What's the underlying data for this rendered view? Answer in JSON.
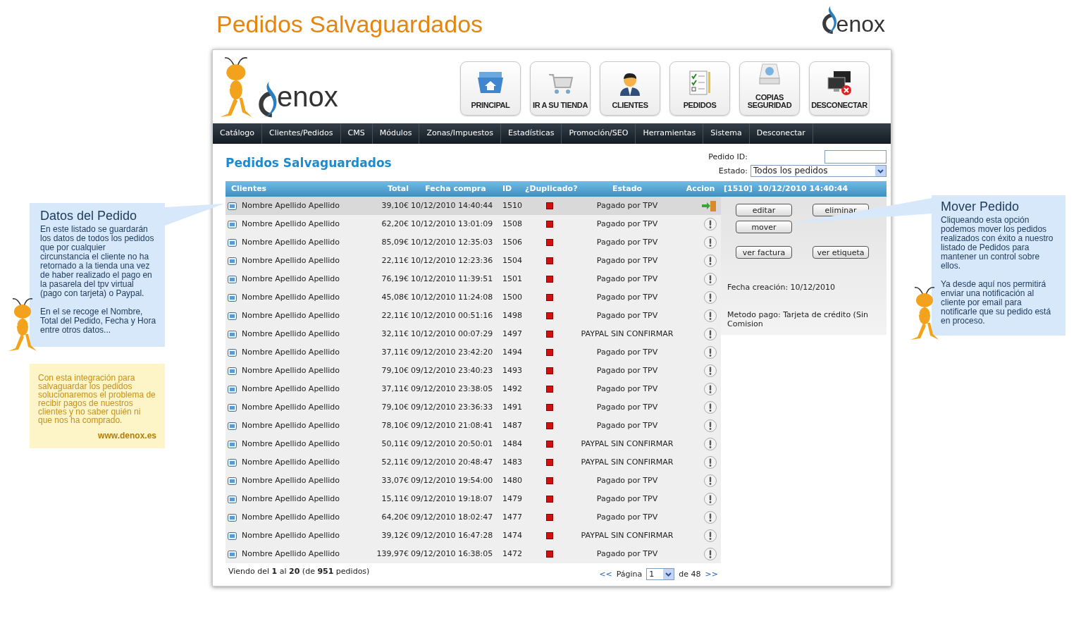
{
  "page_title": "Pedidos Salvaguardados",
  "top_logo_text": "enox",
  "header": {
    "logo_text": "enox",
    "buttons": [
      {
        "label": "PRINCIPAL",
        "kind": "home"
      },
      {
        "label": "IR A SU TIENDA",
        "kind": "cart"
      },
      {
        "label": "CLIENTES",
        "kind": "user"
      },
      {
        "label": "PEDIDOS",
        "kind": "orders"
      },
      {
        "label": "COPIAS SEGURIDAD",
        "kind": "backup"
      },
      {
        "label": "DESCONECTAR",
        "kind": "disconnect"
      }
    ]
  },
  "nav": [
    "Catálogo",
    "Clientes/Pedidos",
    "CMS",
    "Módulos",
    "Zonas/Impuestos",
    "Estadísticas",
    "Promoción/SEO",
    "Herramientas",
    "Sistema",
    "Desconectar"
  ],
  "section_title": "Pedidos Salvaguardados",
  "filters": {
    "order_id_label": "Pedido ID:",
    "status_label": "Estado:",
    "status_value": "Todos los pedidos"
  },
  "table": {
    "columns": [
      "Clientes",
      "Total",
      "Fecha compra",
      "ID",
      "¿Duplicado?",
      "Estado",
      "Accion"
    ],
    "detail_heading": "[1510]  10/12/2010 14:40:44",
    "rows": [
      {
        "client": "Nombre Apellido Apellido",
        "total": "39,10€",
        "date": "10/12/2010 14:40:44",
        "id": "1510",
        "duplicated": true,
        "status": "Pagado por TPV",
        "kind": "move",
        "selected": true
      },
      {
        "client": "Nombre Apellido Apellido",
        "total": "62,20€",
        "date": "10/12/2010 13:01:09",
        "id": "1508",
        "duplicated": true,
        "status": "Pagado por TPV",
        "kind": "alert",
        "selected": false
      },
      {
        "client": "Nombre Apellido Apellido",
        "total": "85,09€",
        "date": "10/12/2010 12:35:03",
        "id": "1506",
        "duplicated": true,
        "status": "Pagado por TPV",
        "kind": "alert",
        "selected": false
      },
      {
        "client": "Nombre Apellido Apellido",
        "total": "22,11€",
        "date": "10/12/2010 12:23:36",
        "id": "1504",
        "duplicated": true,
        "status": "Pagado por TPV",
        "kind": "alert",
        "selected": false
      },
      {
        "client": "Nombre Apellido Apellido",
        "total": "76,19€",
        "date": "10/12/2010 11:39:51",
        "id": "1501",
        "duplicated": true,
        "status": "Pagado por TPV",
        "kind": "alert",
        "selected": false
      },
      {
        "client": "Nombre Apellido Apellido",
        "total": "45,08€",
        "date": "10/12/2010 11:24:08",
        "id": "1500",
        "duplicated": true,
        "status": "Pagado por TPV",
        "kind": "alert",
        "selected": false
      },
      {
        "client": "Nombre Apellido Apellido",
        "total": "22,11€",
        "date": "10/12/2010 00:51:16",
        "id": "1498",
        "duplicated": true,
        "status": "Pagado por TPV",
        "kind": "alert",
        "selected": false
      },
      {
        "client": "Nombre Apellido Apellido",
        "total": "32,11€",
        "date": "10/12/2010 00:07:29",
        "id": "1497",
        "duplicated": true,
        "status": "PAYPAL SIN CONFIRMAR",
        "kind": "alert",
        "selected": false
      },
      {
        "client": "Nombre Apellido Apellido",
        "total": "37,11€",
        "date": "09/12/2010 23:42:20",
        "id": "1494",
        "duplicated": true,
        "status": "Pagado por TPV",
        "kind": "alert",
        "selected": false
      },
      {
        "client": "Nombre Apellido Apellido",
        "total": "79,10€",
        "date": "09/12/2010 23:40:23",
        "id": "1493",
        "duplicated": true,
        "status": "Pagado por TPV",
        "kind": "alert",
        "selected": false
      },
      {
        "client": "Nombre Apellido Apellido",
        "total": "37,11€",
        "date": "09/12/2010 23:38:05",
        "id": "1492",
        "duplicated": true,
        "status": "Pagado por TPV",
        "kind": "alert",
        "selected": false
      },
      {
        "client": "Nombre Apellido Apellido",
        "total": "79,10€",
        "date": "09/12/2010 23:36:33",
        "id": "1491",
        "duplicated": true,
        "status": "Pagado por TPV",
        "kind": "alert",
        "selected": false
      },
      {
        "client": "Nombre Apellido Apellido",
        "total": "78,10€",
        "date": "09/12/2010 21:08:41",
        "id": "1487",
        "duplicated": true,
        "status": "Pagado por TPV",
        "kind": "alert",
        "selected": false
      },
      {
        "client": "Nombre Apellido Apellido",
        "total": "50,11€",
        "date": "09/12/2010 20:50:01",
        "id": "1484",
        "duplicated": true,
        "status": "PAYPAL SIN CONFIRMAR",
        "kind": "alert",
        "selected": false
      },
      {
        "client": "Nombre Apellido Apellido",
        "total": "52,11€",
        "date": "09/12/2010 20:48:47",
        "id": "1483",
        "duplicated": true,
        "status": "PAYPAL SIN CONFIRMAR",
        "kind": "alert",
        "selected": false
      },
      {
        "client": "Nombre Apellido Apellido",
        "total": "33,07€",
        "date": "09/12/2010 19:54:00",
        "id": "1480",
        "duplicated": true,
        "status": "Pagado por TPV",
        "kind": "alert",
        "selected": false
      },
      {
        "client": "Nombre Apellido Apellido",
        "total": "15,11€",
        "date": "09/12/2010 19:18:07",
        "id": "1479",
        "duplicated": true,
        "status": "Pagado por TPV",
        "kind": "alert",
        "selected": false
      },
      {
        "client": "Nombre Apellido Apellido",
        "total": "64,20€",
        "date": "09/12/2010 18:02:47",
        "id": "1477",
        "duplicated": true,
        "status": "Pagado por TPV",
        "kind": "alert",
        "selected": false
      },
      {
        "client": "Nombre Apellido Apellido",
        "total": "39,12€",
        "date": "09/12/2010 16:47:28",
        "id": "1474",
        "duplicated": true,
        "status": "PAYPAL SIN CONFIRMAR",
        "kind": "alert",
        "selected": false
      },
      {
        "client": "Nombre Apellido Apellido",
        "total": "139,97€",
        "date": "09/12/2010 16:38:05",
        "id": "1472",
        "duplicated": true,
        "status": "Pagado por TPV",
        "kind": "alert",
        "selected": false
      }
    ]
  },
  "detail": {
    "buttons": [
      "editar",
      "eliminar",
      "mover",
      "ver factura",
      "ver etiqueta"
    ],
    "created": "Fecha creación: 10/12/2010",
    "payment": "Metodo pago: Tarjeta de crédito (Sin Comision"
  },
  "footer": {
    "summary": "Viendo del **1** al **20** (de **951** pedidos)",
    "prev": "<<",
    "page_label": "Página",
    "page_value": "1",
    "page_total": "de 48",
    "next": ">>"
  },
  "callouts": [
    {
      "title": "Datos del Pedido",
      "paragraphs": [
        "En este listado se guardarán los datos de todos los pedidos que por cualquier circunstancia el cliente no ha retornado a la tienda una vez de haber realizado el pago en la pasarela del tpv virtual (pago con tarjeta) o Paypal.",
        "En el se recoge el Nombre, Total del Pedido, Fecha y Hora entre otros datos..."
      ]
    },
    {
      "title": "Mover Pedido",
      "paragraphs": [
        "Cliqueando esta opción podemos mover los pedidos realizados con éxito a nuestro listado de Pedidos para mantener un control sobre ellos.",
        "Ya desde aquí nos permitirá enviar una notificación al cliente por email para notificarle que su pedido está en proceso."
      ]
    }
  ],
  "note": {
    "text": "Con esta integración para salvaguardar los pedidos solucionaremos el problema de recibir pagos de nuestros clientes y no saber  quién ni que nos ha comprado.",
    "link": "www.denox.es"
  }
}
